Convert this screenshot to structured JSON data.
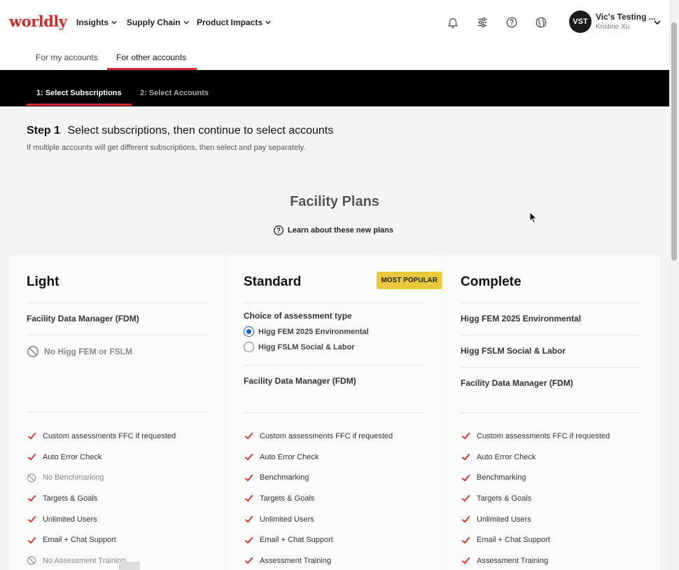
{
  "header": {
    "logo": "worldly",
    "nav": [
      {
        "label": "Insights"
      },
      {
        "label": "Supply Chain"
      },
      {
        "label": "Product Impacts"
      }
    ],
    "icons": [
      "bell-icon",
      "sliders-icon",
      "help-icon",
      "globe-icon"
    ],
    "profile": {
      "initials": "VST",
      "name": "Vic's Testing ...",
      "user": "Kristine Xu"
    }
  },
  "subtabs": [
    {
      "label": "For my accounts",
      "active": false
    },
    {
      "label": "For other accounts",
      "active": true
    }
  ],
  "steps": [
    {
      "label": "1: Select Subscriptions",
      "active": true
    },
    {
      "label": "2: Select Accounts",
      "active": false
    }
  ],
  "step": {
    "prefix": "Step 1",
    "title": "Select subscriptions, then continue to select accounts",
    "description": "If multiple accounts will get different subscriptions, then select and pay separately."
  },
  "section": {
    "title": "Facility Plans",
    "learn_link": "Learn about these new plans"
  },
  "plans": {
    "light": {
      "title": "Light",
      "main": "Facility Data Manager (FDM)",
      "none": "No Higg FEM or FSLM",
      "features": [
        {
          "label": "Custom assessments FFC if requested",
          "included": true
        },
        {
          "label": "Auto Error Check",
          "included": true
        },
        {
          "label": "No Benchmarking",
          "included": false
        },
        {
          "label": "Targets & Goals",
          "included": true
        },
        {
          "label": "Unlimited Users",
          "included": true
        },
        {
          "label": "Email + Chat Support",
          "included": true
        },
        {
          "label": "No Assessment Training",
          "included": false
        }
      ]
    },
    "standard": {
      "title": "Standard",
      "badge": "MOST POPULAR",
      "choice_label": "Choice of assessment type",
      "options": [
        {
          "label": "Higg FEM 2025 Environmental",
          "selected": true
        },
        {
          "label": "Higg FSLM Social & Labor",
          "selected": false
        }
      ],
      "main": "Facility Data Manager (FDM)",
      "features": [
        {
          "label": "Custom assessments FFC if requested",
          "included": true
        },
        {
          "label": "Auto Error Check",
          "included": true
        },
        {
          "label": "Benchmarking",
          "included": true
        },
        {
          "label": "Targets & Goals",
          "included": true
        },
        {
          "label": "Unlimited Users",
          "included": true
        },
        {
          "label": "Email + Chat Support",
          "included": true
        },
        {
          "label": "Assessment Training",
          "included": true
        }
      ]
    },
    "complete": {
      "title": "Complete",
      "mains": [
        "Higg FEM 2025 Environmental",
        "Higg FSLM Social & Labor",
        "Facility Data Manager (FDM)"
      ],
      "features": [
        {
          "label": "Custom assessments FFC if requested",
          "included": true
        },
        {
          "label": "Auto Error Check",
          "included": true
        },
        {
          "label": "Benchmarking",
          "included": true
        },
        {
          "label": "Targets & Goals",
          "included": true
        },
        {
          "label": "Unlimited Users",
          "included": true
        },
        {
          "label": "Email + Chat Support",
          "included": true
        },
        {
          "label": "Assessment Training",
          "included": true
        }
      ]
    }
  },
  "colors": {
    "brand": "#d42b2b",
    "badge": "#e8c93a",
    "radio": "#1a5ad6"
  }
}
